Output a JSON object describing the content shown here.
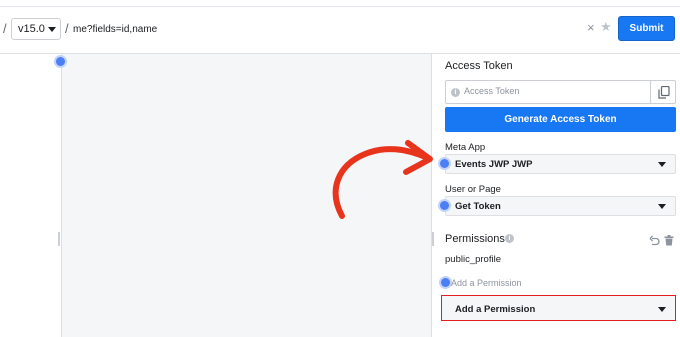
{
  "toolbar": {
    "version": "v15.0",
    "query": "me?fields=id,name",
    "clear_glyph": "×",
    "star_glyph": "★",
    "submit_label": "Submit",
    "separator": "/"
  },
  "access_token": {
    "title": "Access Token",
    "placeholder": "Access Token",
    "generate_label": "Generate Access Token"
  },
  "meta_app": {
    "label": "Meta App",
    "selected": "Events JWP JWP"
  },
  "user_or_page": {
    "label": "User or Page",
    "selected": "Get Token"
  },
  "permissions": {
    "title": "Permissions",
    "items": [
      "public_profile"
    ],
    "add_placeholder": "Add a Permission",
    "add_select_label": "Add a Permission"
  },
  "colors": {
    "accent": "#1877f2",
    "annotation": "#e8341c",
    "highlight_border": "#e41e1e",
    "dot": "#4a7ff5"
  },
  "icons": [
    "info-icon",
    "copy-icon",
    "undo-icon",
    "trash-icon",
    "chevron-down-icon",
    "clear-icon",
    "star-icon"
  ]
}
